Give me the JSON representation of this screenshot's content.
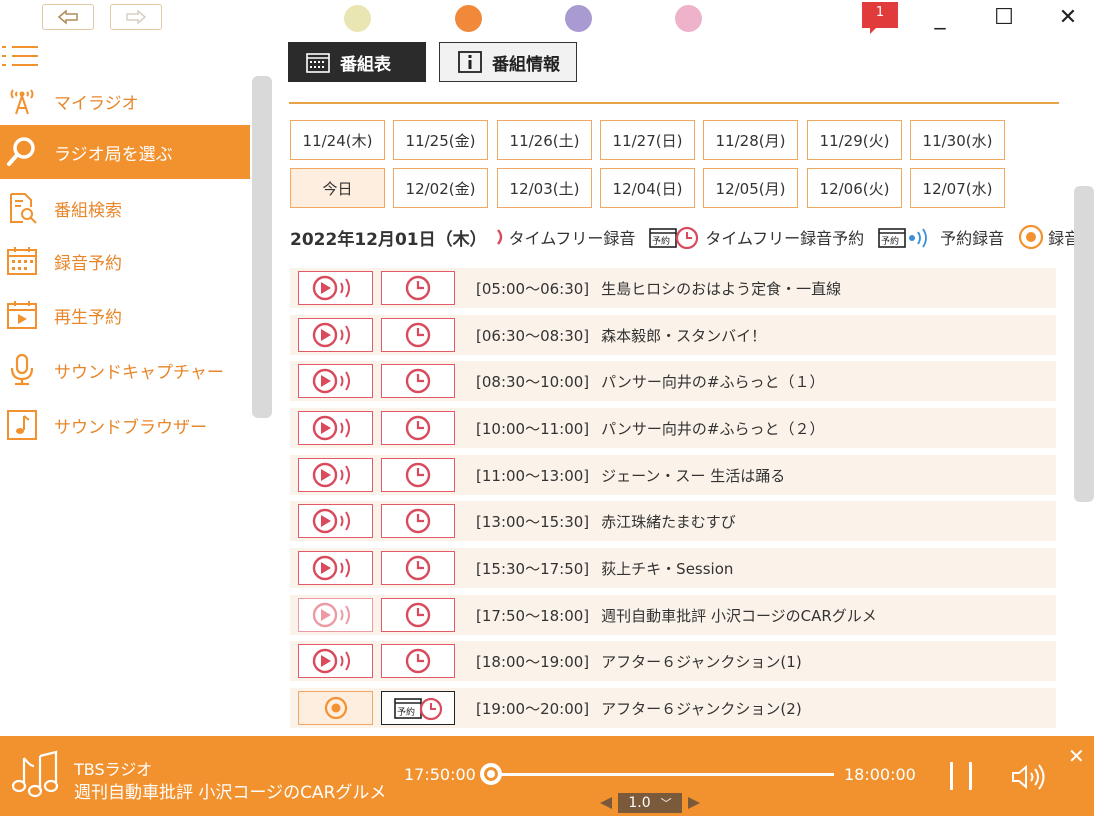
{
  "titlebar": {
    "notification_count": "1",
    "theme_colors": [
      "#e9e6b4",
      "#f08a3a",
      "#a99bd2",
      "#eeb2cb"
    ],
    "minimize": "_",
    "maximize": "☐",
    "close": "✕"
  },
  "sidebar": {
    "items": [
      {
        "label": "マイラジオ",
        "icon": "antenna-icon"
      },
      {
        "label": "ラジオ局を選ぶ",
        "icon": "search-icon",
        "active": true
      },
      {
        "label": "番組検索",
        "icon": "document-search-icon"
      },
      {
        "label": "録音予約",
        "icon": "calendar-icon"
      },
      {
        "label": "再生予約",
        "icon": "play-calendar-icon"
      },
      {
        "label": "サウンドキャプチャー",
        "icon": "microphone-icon"
      },
      {
        "label": "サウンドブラウザー",
        "icon": "music-note-icon"
      }
    ]
  },
  "tabs": {
    "schedule": "番組表",
    "info": "番組情報"
  },
  "dates": {
    "row1": [
      "11/24(木)",
      "11/25(金)",
      "11/26(土)",
      "11/27(日)",
      "11/28(月)",
      "11/29(火)",
      "11/30(水)"
    ],
    "row2": [
      "今日",
      "12/02(金)",
      "12/03(土)",
      "12/04(日)",
      "12/05(月)",
      "12/06(火)",
      "12/07(水)"
    ]
  },
  "legend": {
    "date": "2022年12月01日（木）",
    "timefree": "タイムフリー録音",
    "timefree_reserve": "タイムフリー録音予約",
    "reserve": "予約録音",
    "record": "録音"
  },
  "programs": [
    {
      "time": "[05:00～06:30]",
      "title": "生島ヒロシのおはよう定食・一直線"
    },
    {
      "time": "[06:30～08:30]",
      "title": "森本毅郎・スタンバイ！"
    },
    {
      "time": "[08:30～10:00]",
      "title": "パンサー向井の#ふらっと（１）"
    },
    {
      "time": "[10:00～11:00]",
      "title": "パンサー向井の#ふらっと（２）"
    },
    {
      "time": "[11:00～13:00]",
      "title": "ジェーン・スー 生活は踊る"
    },
    {
      "time": "[13:00～15:30]",
      "title": "赤江珠緒たまむすび"
    },
    {
      "time": "[15:30～17:50]",
      "title": "荻上チキ・Session"
    },
    {
      "time": "[17:50～18:00]",
      "title": "週刊自動車批評 小沢コージのCARグルメ"
    },
    {
      "time": "[18:00～19:00]",
      "title": "アフター６ジャンクション(1)"
    },
    {
      "time": "[19:00～20:00]",
      "title": "アフター６ジャンクション(2)"
    }
  ],
  "player": {
    "station": "TBSラジオ",
    "title": "週刊自動車批評 小沢コージのCARグルメ",
    "start_time": "17:50:00",
    "end_time": "18:00:00",
    "speed": "1.0",
    "progress": 0
  },
  "colors": {
    "accent": "#f2922f",
    "record_border": "#e05a6a"
  }
}
